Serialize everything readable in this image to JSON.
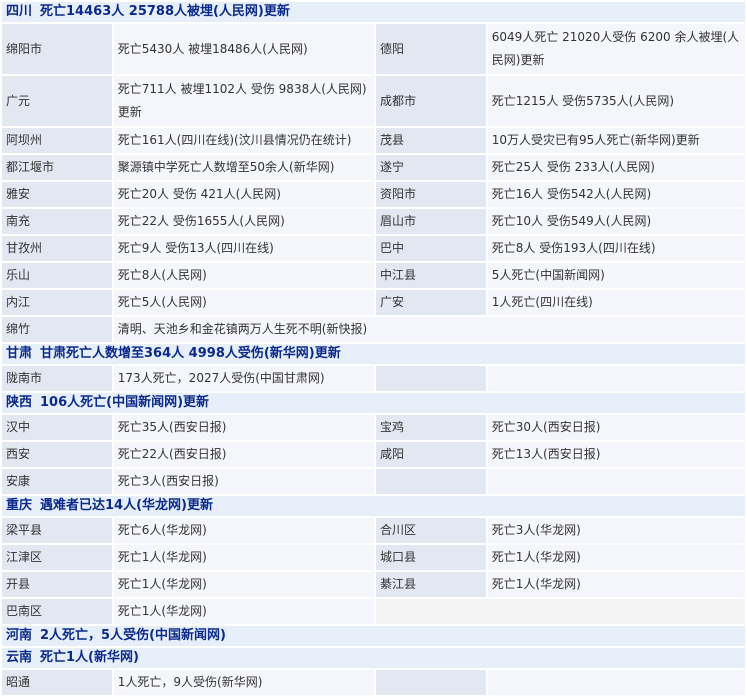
{
  "sections": [
    {
      "province": "四川",
      "headline": "死亡14463人 25788人被埋(人民网)更新",
      "rows": [
        {
          "l1": "绵阳市",
          "v1": "死亡5430人 被埋18486人(人民网)",
          "l2": "德阳",
          "v2": "6049人死亡 21020人受伤 6200 余人被埋(人民网)更新"
        },
        {
          "l1": "广元",
          "v1": "死亡711人 被埋1102人 受伤 9838人(人民网)更新",
          "l2": "成都市",
          "v2": "死亡1215人 受伤5735人(人民网)"
        },
        {
          "l1": "阿坝州",
          "v1": "死亡161人(四川在线)(汶川县情况仍在统计)",
          "l2": "茂县",
          "v2": "10万人受灾已有95人死亡(新华网)更新"
        },
        {
          "l1": "都江堰市",
          "v1": "聚源镇中学死亡人数增至50余人(新华网)",
          "l2": "遂宁",
          "v2": "死亡25人 受伤 233人(人民网)"
        },
        {
          "l1": "雅安",
          "v1": "死亡20人 受伤 421人(人民网)",
          "l2": "资阳市",
          "v2": "死亡16人 受伤542人(人民网)"
        },
        {
          "l1": "南充",
          "v1": "死亡22人 受伤1655人(人民网)",
          "l2": "眉山市",
          "v2": "死亡10人 受伤549人(人民网)"
        },
        {
          "l1": "甘孜州",
          "v1": "死亡9人 受伤13人(四川在线)",
          "l2": "巴中",
          "v2": "死亡8人 受伤193人(四川在线)"
        },
        {
          "l1": "乐山",
          "v1": "死亡8人(人民网)",
          "l2": "中江县",
          "v2": "5人死亡(中国新闻网)"
        },
        {
          "l1": "内江",
          "v1": "死亡5人(人民网)",
          "l2": "广安",
          "v2": "1人死亡(四川在线)"
        },
        {
          "l1": "绵竹",
          "v1": "清明、天池乡和金花镇两万人生死不明(新快报)",
          "span": true
        }
      ]
    },
    {
      "province": "甘肃",
      "headline": "甘肃死亡人数增至364人 4998人受伤(新华网)更新",
      "rows": [
        {
          "l1": "陇南市",
          "v1": "173人死亡，2027人受伤(中国甘肃网)",
          "l2": "",
          "v2": ""
        }
      ]
    },
    {
      "province": "陕西",
      "headline": "106人死亡(中国新闻网)更新",
      "rows": [
        {
          "l1": "汉中",
          "v1": "死亡35人(西安日报)",
          "l2": "宝鸡",
          "v2": "死亡30人(西安日报)"
        },
        {
          "l1": "西安",
          "v1": "死亡22人(西安日报)",
          "l2": "咸阳",
          "v2": "死亡13人(西安日报)"
        },
        {
          "l1": "安康",
          "v1": "死亡3人(西安日报)",
          "l2": "",
          "v2": ""
        }
      ]
    },
    {
      "province": "重庆",
      "headline": "遇难者已达14人(华龙网)更新",
      "rows": [
        {
          "l1": "梁平县",
          "v1": "死亡6人(华龙网)",
          "l2": "合川区",
          "v2": "死亡3人(华龙网)"
        },
        {
          "l1": "江津区",
          "v1": "死亡1人(华龙网)",
          "l2": "城口县",
          "v2": "死亡1人(华龙网)"
        },
        {
          "l1": "开县",
          "v1": "死亡1人(华龙网)",
          "l2": "綦江县",
          "v2": "死亡1人(华龙网)"
        },
        {
          "l1": "巴南区",
          "v1": "死亡1人(华龙网)",
          "blank": true
        }
      ]
    },
    {
      "province": "河南",
      "headline": "2人死亡，5人受伤(中国新闻网)",
      "rows": []
    },
    {
      "province": "云南",
      "headline": "死亡1人(新华网)",
      "rows": [
        {
          "l1": "昭通",
          "v1": "1人死亡，9人受伤(新华网)",
          "l2": "",
          "v2": ""
        }
      ]
    }
  ]
}
